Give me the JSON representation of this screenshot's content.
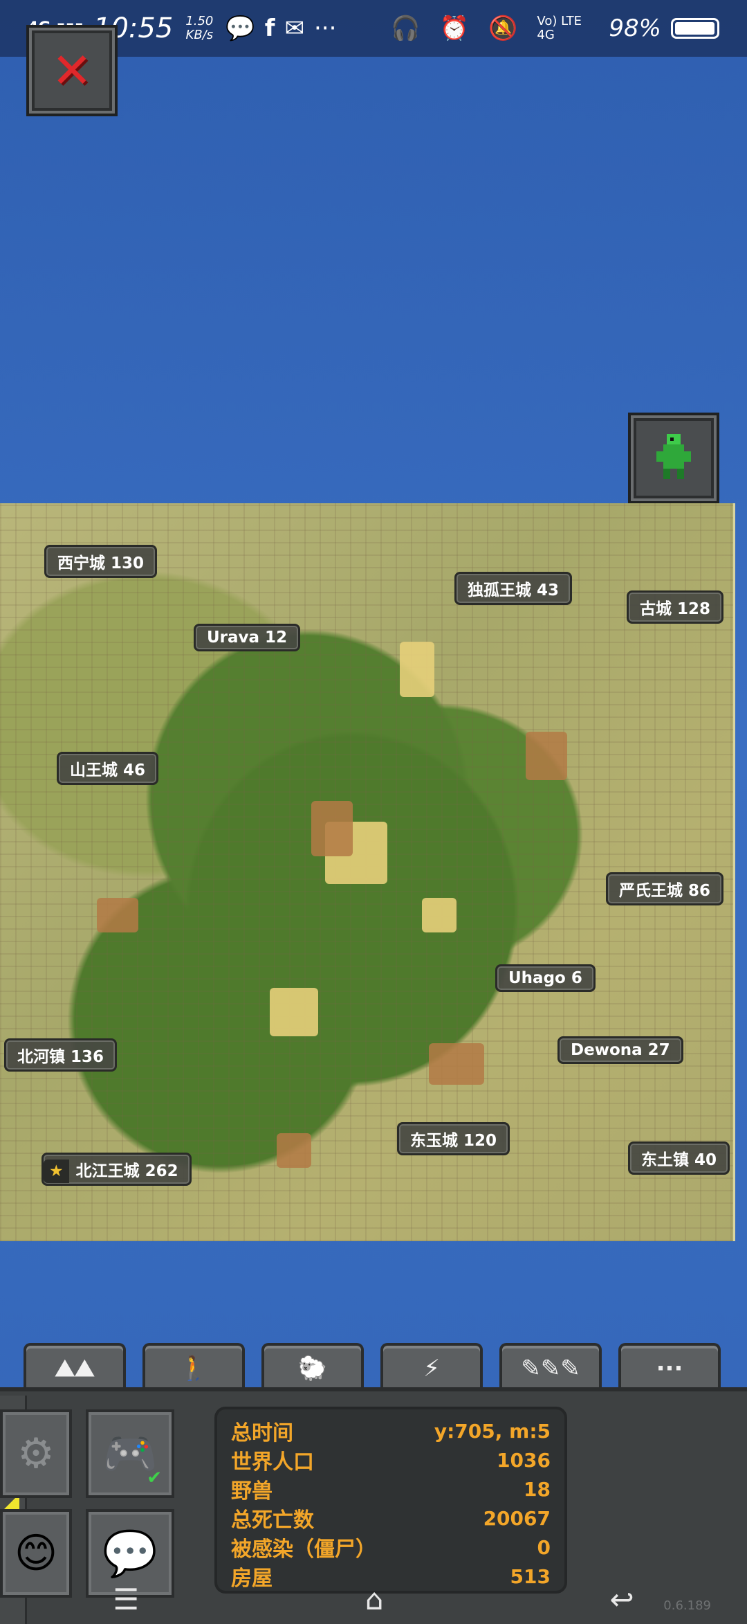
{
  "status_bar": {
    "network": "4G",
    "time": "10:55",
    "speed_value": "1.50",
    "speed_unit": "KB/s",
    "more": "···",
    "signal": "Vo) LTE 4G",
    "battery": "98%",
    "battery_level": 0.98
  },
  "buttons": {
    "close": "✕"
  },
  "cities": [
    {
      "label": "西宁城  130"
    },
    {
      "label": "独孤王城  43"
    },
    {
      "label": "古城  128"
    },
    {
      "label": "Urava  12"
    },
    {
      "label": "山王城  46"
    },
    {
      "label": "严氏王城  86"
    },
    {
      "label": "Uhago  6"
    },
    {
      "label": "北河镇  136"
    },
    {
      "label": "Dewona  27"
    },
    {
      "label": "东玉城  120"
    },
    {
      "label": "北江王城  262",
      "capital": true
    },
    {
      "label": "东土镇  40"
    }
  ],
  "tabs": [
    {
      "icon": "mountains-icon"
    },
    {
      "icon": "person-icon"
    },
    {
      "icon": "sheep-icon"
    },
    {
      "icon": "storm-icon"
    },
    {
      "icon": "tools-icon"
    },
    {
      "icon": "more-icon",
      "text": "···"
    }
  ],
  "stats": {
    "rows": [
      {
        "key": "总时间",
        "value": "y:705, m:5"
      },
      {
        "key": "世界人口",
        "value": "1036"
      },
      {
        "key": "野兽",
        "value": "18"
      },
      {
        "key": "总死亡数",
        "value": "20067"
      },
      {
        "key": "被感染（僵尸）",
        "value": "0"
      },
      {
        "key": "房屋",
        "value": "513"
      }
    ]
  },
  "version": "0.6.189",
  "colors": {
    "accent": "#f3a629",
    "ocean": "#3466b8",
    "panel": "#3e4142"
  }
}
